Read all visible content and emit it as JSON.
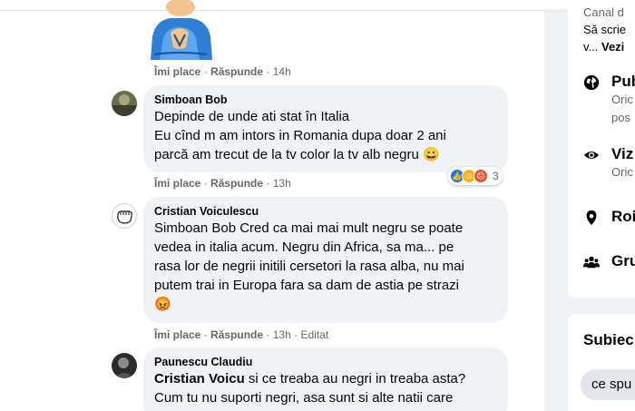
{
  "feed": {
    "like_label": "Îmi place",
    "reply_label": "Răspunde",
    "separator": "·",
    "comments": [
      {
        "time": "14h"
      },
      {
        "author": "Simboan Bob",
        "lines": [
          "Depinde de unde ati stat în Italia",
          "Eu cînd m am intors in Romania dupa doar 2 ani",
          "parcă am trecut de la tv color la tv alb negru 😀"
        ],
        "time": "13h",
        "reaction_count": "3"
      },
      {
        "author": "Cristian Voiculescu",
        "lines": [
          "Simboan Bob Cred ca mai mai mult negru se poate",
          "vedea in italia acum. Negru din Africa, sa ma... pe",
          "rasa lor de negrii initili cersetori la rasa alba, nu mai",
          "putem trai in Europa fara sa dam de astia pe strazi",
          "😡"
        ],
        "time": "13h",
        "edited": "Editat"
      },
      {
        "author": "Paunescu Claudiu",
        "mention": "Cristian Voicu",
        "lines": [
          " si ce treaba au negri in treaba asta?",
          "Cum tu nu suporti negri, asa sunt si alte natii care"
        ]
      }
    ]
  },
  "sidebar": {
    "intro_lines": [
      "Canal d",
      "Să scrie",
      "v... "
    ],
    "see_more": "Vezi",
    "rows": [
      {
        "icon": "globe-icon",
        "title": "Pub",
        "sub": [
          "Oric",
          "pos"
        ]
      },
      {
        "icon": "eye-icon",
        "title": "Viz",
        "sub": [
          "Oric"
        ]
      },
      {
        "icon": "location-pin-icon",
        "title": "Roi",
        "sub": []
      },
      {
        "icon": "group-icon",
        "title": "Gru",
        "sub": []
      }
    ],
    "topics_heading": "Subiec",
    "chip": "ce spu"
  },
  "colors": {
    "bubble": "#f0f2f5",
    "muted": "#65676b",
    "like_blue": "#1877f2",
    "angry_orange": "#f0522f"
  }
}
